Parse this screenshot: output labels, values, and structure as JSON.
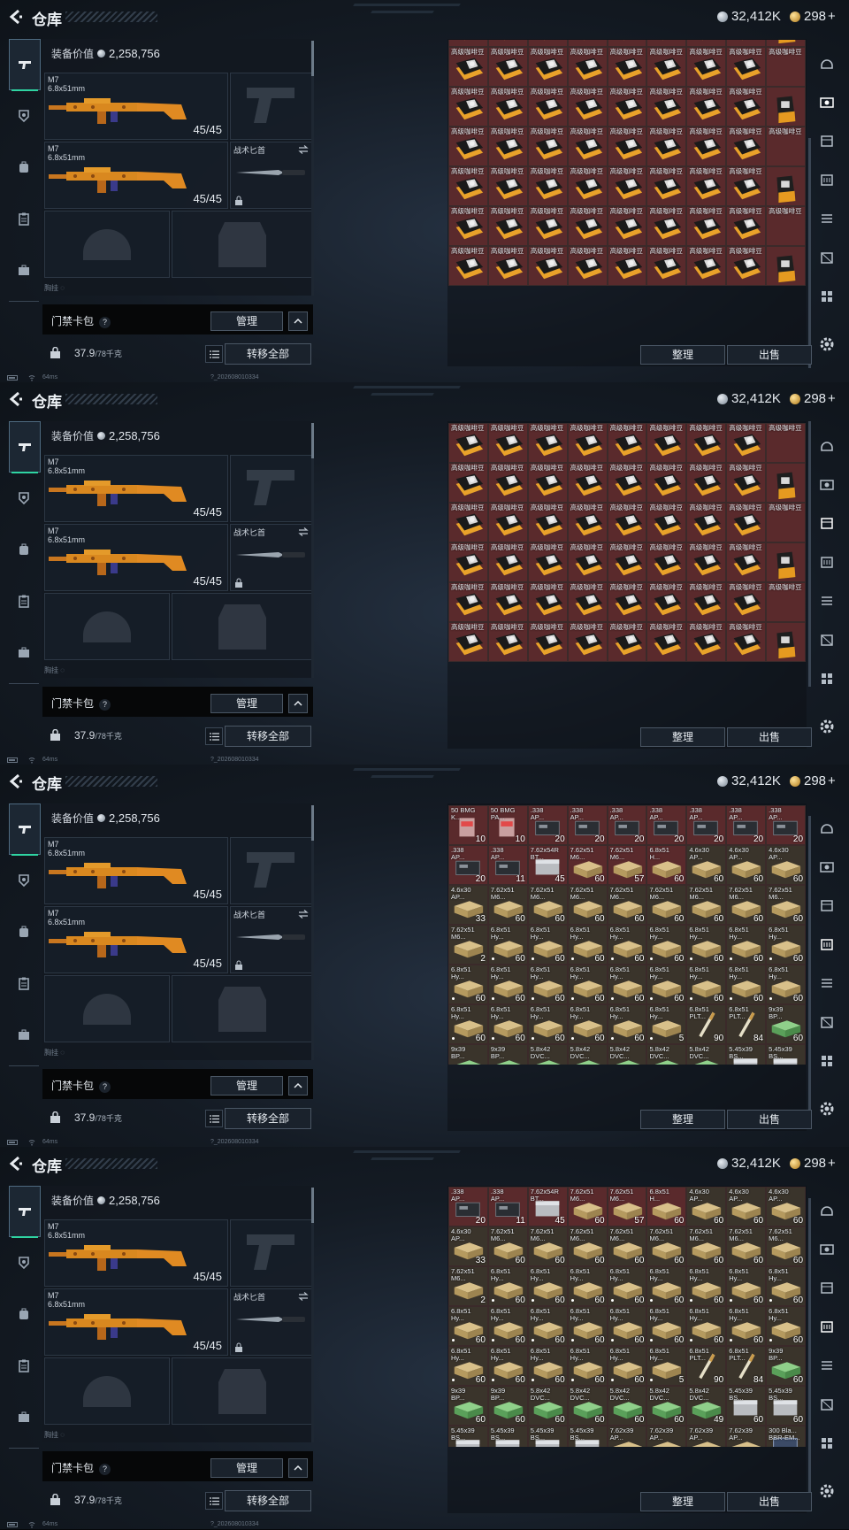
{
  "screens": [
    {
      "title": "仓库",
      "currency_silver": "32,412K",
      "currency_gold": "298",
      "currency_gold_plus": "+",
      "equip_value_label": "装备价值",
      "equip_value": "2,258,756",
      "gun1": {
        "name": "M7",
        "caliber": "6.8x51mm",
        "ammo": "45/45"
      },
      "gun2": {
        "name": "M7",
        "caliber": "6.8x51mm",
        "ammo": "45/45"
      },
      "knife_label": "战术匕首",
      "slot_partial": "胸挂 ◌",
      "keycard_label": "门禁卡包",
      "help": "?",
      "manage": "管理",
      "collapse": "^",
      "weight": "37.9",
      "weight_max": "/78千克",
      "transfer_all": "转移全部",
      "sort": "整理",
      "sell": "出售",
      "ping": "64ms",
      "build": "?_202608010334",
      "active_right": 1
    },
    {
      "title": "仓库",
      "currency_silver": "32,412K",
      "currency_gold": "298",
      "currency_gold_plus": "+",
      "equip_value_label": "装备价值",
      "equip_value": "2,258,756",
      "gun1": {
        "name": "M7",
        "caliber": "6.8x51mm",
        "ammo": "45/45"
      },
      "gun2": {
        "name": "M7",
        "caliber": "6.8x51mm",
        "ammo": "45/45"
      },
      "knife_label": "战术匕首",
      "slot_partial": "胸挂 ◌",
      "keycard_label": "门禁卡包",
      "help": "?",
      "manage": "管理",
      "collapse": "^",
      "weight": "37.9",
      "weight_max": "/78千克",
      "transfer_all": "转移全部",
      "sort": "整理",
      "sell": "出售",
      "ping": "64ms",
      "build": "?_202608010334",
      "active_right": 2
    },
    {
      "title": "仓库",
      "currency_silver": "32,412K",
      "currency_gold": "298",
      "currency_gold_plus": "+",
      "equip_value_label": "装备价值",
      "equip_value": "2,258,756",
      "gun1": {
        "name": "M7",
        "caliber": "6.8x51mm",
        "ammo": "45/45"
      },
      "gun2": {
        "name": "M7",
        "caliber": "6.8x51mm",
        "ammo": "45/45"
      },
      "knife_label": "战术匕首",
      "slot_partial": "胸挂 ◌",
      "keycard_label": "门禁卡包",
      "help": "?",
      "manage": "管理",
      "collapse": "^",
      "weight": "37.9",
      "weight_max": "/78千克",
      "transfer_all": "转移全部",
      "sort": "整理",
      "sell": "出售",
      "ping": "64ms",
      "build": "?_202608010334",
      "active_right": 3
    },
    {
      "title": "仓库",
      "currency_silver": "32,412K",
      "currency_gold": "298",
      "currency_gold_plus": "+",
      "equip_value_label": "装备价值",
      "equip_value": "2,258,756",
      "gun1": {
        "name": "M7",
        "caliber": "6.8x51mm",
        "ammo": "45/45"
      },
      "gun2": {
        "name": "M7",
        "caliber": "6.8x51mm",
        "ammo": "45/45"
      },
      "knife_label": "战术匕首",
      "slot_partial": "胸挂 ◌",
      "keycard_label": "门禁卡包",
      "help": "?",
      "manage": "管理",
      "collapse": "^",
      "weight": "37.9",
      "weight_max": "/78千克",
      "transfer_all": "转移全部",
      "sort": "整理",
      "sell": "出售",
      "ping": "64ms",
      "build": "?_202608010334",
      "active_right": 3
    }
  ],
  "coffee_grid": {
    "label": "高级咖啡豆",
    "rows_screen1": [
      [
        "",
        "",
        "",
        "",
        "",
        "",
        "",
        "",
        ""
      ],
      [
        "高级咖啡豆",
        "高级咖啡豆",
        "高级咖啡豆",
        "高级咖啡豆",
        "高级咖啡豆",
        "高级咖啡豆",
        "高级咖啡豆",
        "高级咖啡豆",
        "高级咖啡豆"
      ],
      [
        "高级咖啡豆",
        "高级咖啡豆",
        "高级咖啡豆",
        "高级咖啡豆",
        "高级咖啡豆",
        "高级咖啡豆",
        "高级咖啡豆",
        "高级咖啡豆",
        ""
      ],
      [
        "高级咖啡豆",
        "高级咖啡豆",
        "高级咖啡豆",
        "高级咖啡豆",
        "高级咖啡豆",
        "高级咖啡豆",
        "高级咖啡豆",
        "高级咖啡豆",
        "高级咖啡豆"
      ],
      [
        "高级咖啡豆",
        "高级咖啡豆",
        "高级咖啡豆",
        "高级咖啡豆",
        "高级咖啡豆",
        "高级咖啡豆",
        "高级咖啡豆",
        "高级咖啡豆",
        ""
      ],
      [
        "高级咖啡豆",
        "高级咖啡豆",
        "高级咖啡豆",
        "高级咖啡豆",
        "高级咖啡豆",
        "高级咖啡豆",
        "高级咖啡豆",
        "高级咖啡豆",
        "高级咖啡豆"
      ],
      [
        "高级咖啡豆",
        "高级咖啡豆",
        "高级咖啡豆",
        "高级咖啡豆",
        "高级咖啡豆",
        "高级咖啡豆",
        "高级咖啡豆",
        "高级咖啡豆",
        ""
      ]
    ],
    "rows_screen2": [
      [
        "高级咖啡豆",
        "高级咖啡豆",
        "高级咖啡豆",
        "高级咖啡豆",
        "高级咖啡豆",
        "高级咖啡豆",
        "高级咖啡豆",
        "高级咖啡豆",
        "高级咖啡豆"
      ],
      [
        "高级咖啡豆",
        "高级咖啡豆",
        "高级咖啡豆",
        "高级咖啡豆",
        "高级咖啡豆",
        "高级咖啡豆",
        "高级咖啡豆",
        "高级咖啡豆",
        ""
      ],
      [
        "高级咖啡豆",
        "高级咖啡豆",
        "高级咖啡豆",
        "高级咖啡豆",
        "高级咖啡豆",
        "高级咖啡豆",
        "高级咖啡豆",
        "高级咖啡豆",
        "高级咖啡豆"
      ],
      [
        "高级咖啡豆",
        "高级咖啡豆",
        "高级咖啡豆",
        "高级咖啡豆",
        "高级咖啡豆",
        "高级咖啡豆",
        "高级咖啡豆",
        "高级咖啡豆",
        ""
      ],
      [
        "高级咖啡豆",
        "高级咖啡豆",
        "高级咖啡豆",
        "高级咖啡豆",
        "高级咖啡豆",
        "高级咖啡豆",
        "高级咖啡豆",
        "高级咖啡豆",
        "高级咖啡豆"
      ],
      [
        "高级咖啡豆",
        "高级咖啡豆",
        "高级咖啡豆",
        "高级咖啡豆",
        "高级咖啡豆",
        "高级咖啡豆",
        "高级咖啡豆",
        "高级咖啡豆",
        ""
      ]
    ]
  },
  "ammo_grid": {
    "rows": [
      [
        [
          "50 BMG\nK...",
          "10",
          "red",
          "box"
        ],
        [
          "50 BMG\nPA...",
          "10",
          "red",
          "box"
        ],
        [
          ".338\nAP...",
          "20",
          "red",
          "mag"
        ],
        [
          ".338\nAP...",
          "20",
          "red",
          "mag"
        ],
        [
          ".338\nAP...",
          "20",
          "red",
          "mag"
        ],
        [
          ".338\nAP...",
          "20",
          "red",
          "mag"
        ],
        [
          ".338\nAP...",
          "20",
          "red",
          "mag"
        ],
        [
          ".338\nAP...",
          "20",
          "red",
          "mag"
        ],
        [
          ".338\nAP...",
          "20",
          "red",
          "mag"
        ]
      ],
      [
        [
          ".338\nAP...",
          "20",
          "red",
          "mag"
        ],
        [
          ".338\nAP...",
          "11",
          "red",
          "mag"
        ],
        [
          "7.62x54R\nBT...",
          "45",
          "red",
          "silver"
        ],
        [
          "7.62x51\nM6...",
          "60",
          "red",
          "tan"
        ],
        [
          "7.62x51\nM6...",
          "57",
          "red",
          "tan"
        ],
        [
          "6.8x51\nH...",
          "60",
          "red",
          "tan"
        ],
        [
          "4.6x30\nAP...",
          "60",
          "dark",
          "tan"
        ],
        [
          "4.6x30\nAP...",
          "60",
          "dark",
          "tan"
        ],
        [
          "4.6x30\nAP...",
          "60",
          "dark",
          "tan"
        ]
      ],
      [
        [
          "4.6x30\nAP...",
          "33",
          "dark",
          "tan"
        ],
        [
          "7.62x51\nM6...",
          "60",
          "dark",
          "tan"
        ],
        [
          "7.62x51\nM6...",
          "60",
          "dark",
          "tan"
        ],
        [
          "7.62x51\nM6...",
          "60",
          "dark",
          "tan"
        ],
        [
          "7.62x51\nM6...",
          "60",
          "dark",
          "tan"
        ],
        [
          "7.62x51\nM6...",
          "60",
          "dark",
          "tan"
        ],
        [
          "7.62x51\nM6...",
          "60",
          "dark",
          "tan"
        ],
        [
          "7.62x51\nM6...",
          "60",
          "dark",
          "tan"
        ],
        [
          "7.62x51\nM6...",
          "60",
          "dark",
          "tan"
        ]
      ],
      [
        [
          "7.62x51\nM6...",
          "2",
          "dark",
          "tan"
        ],
        [
          "6.8x51\nHy...",
          "60",
          "dark",
          "tan",
          "dot"
        ],
        [
          "6.8x51\nHy...",
          "60",
          "dark",
          "tan",
          "dot"
        ],
        [
          "6.8x51\nHy...",
          "60",
          "dark",
          "tan",
          "dot"
        ],
        [
          "6.8x51\nHy...",
          "60",
          "dark",
          "tan",
          "dot"
        ],
        [
          "6.8x51\nHy...",
          "60",
          "dark",
          "tan",
          "dot"
        ],
        [
          "6.8x51\nHy...",
          "60",
          "dark",
          "tan",
          "dot"
        ],
        [
          "6.8x51\nHy...",
          "60",
          "dark",
          "tan",
          "dot"
        ],
        [
          "6.8x51\nHy...",
          "60",
          "dark",
          "tan",
          "dot"
        ]
      ],
      [
        [
          "6.8x51\nHy...",
          "60",
          "dark",
          "tan",
          "dot"
        ],
        [
          "6.8x51\nHy...",
          "60",
          "dark",
          "tan",
          "dot"
        ],
        [
          "6.8x51\nHy...",
          "60",
          "dark",
          "tan",
          "dot"
        ],
        [
          "6.8x51\nHy...",
          "60",
          "dark",
          "tan",
          "dot"
        ],
        [
          "6.8x51\nHy...",
          "60",
          "dark",
          "tan",
          "dot"
        ],
        [
          "6.8x51\nHy...",
          "60",
          "dark",
          "tan",
          "dot"
        ],
        [
          "6.8x51\nHy...",
          "60",
          "dark",
          "tan",
          "dot"
        ],
        [
          "6.8x51\nHy...",
          "60",
          "dark",
          "tan",
          "dot"
        ],
        [
          "6.8x51\nHy...",
          "60",
          "dark",
          "tan",
          "dot"
        ]
      ],
      [
        [
          "6.8x51\nHy...",
          "60",
          "dark",
          "tan",
          "dot"
        ],
        [
          "6.8x51\nHy...",
          "60",
          "dark",
          "tan",
          "dot"
        ],
        [
          "6.8x51\nHy...",
          "60",
          "dark",
          "tan",
          "dot"
        ],
        [
          "6.8x51\nHy...",
          "60",
          "dark",
          "tan",
          "dot"
        ],
        [
          "6.8x51\nHy...",
          "60",
          "dark",
          "tan",
          "dot"
        ],
        [
          "6.8x51\nHy...",
          "5",
          "dark",
          "tan",
          "dot"
        ],
        [
          "6.8x51\nPLT...",
          "90",
          "dark",
          "round"
        ],
        [
          "6.8x51\nPLT...",
          "84",
          "dark",
          "round"
        ],
        [
          "9x39\nBP...",
          "60",
          "dark",
          "green"
        ]
      ],
      [
        [
          "9x39\nBP...",
          "60",
          "dark",
          "green"
        ],
        [
          "9x39\nBP...",
          "60",
          "dark",
          "green"
        ],
        [
          "5.8x42\nDVC...",
          "60",
          "dark",
          "green"
        ],
        [
          "5.8x42\nDVC...",
          "60",
          "dark",
          "green"
        ],
        [
          "5.8x42\nDVC...",
          "60",
          "dark",
          "green"
        ],
        [
          "5.8x42\nDVC...",
          "60",
          "dark",
          "green"
        ],
        [
          "5.8x42\nDVC...",
          "49",
          "dark",
          "green"
        ],
        [
          "5.45x39\nBS...",
          "60",
          "dark",
          "silver"
        ],
        [
          "5.45x39\nBS...",
          "60",
          "dark",
          "silver"
        ]
      ],
      [
        [
          "5.45x39\nBS...",
          "60",
          "dark",
          "silver"
        ],
        [
          "5.45x39\nBS...",
          "60",
          "dark",
          "silver"
        ],
        [
          "5.45x39\nBS...",
          "60",
          "dark",
          "silver"
        ],
        [
          "5.45x39\nBS...",
          "60",
          "dark",
          "silver"
        ],
        [
          "7.62x39\nAP...",
          "60",
          "dark",
          "tan"
        ],
        [
          "7.62x39\nAP...",
          "60",
          "dark",
          "tan"
        ],
        [
          "7.62x39\nAP...",
          "60",
          "dark",
          "tan"
        ],
        [
          "7.62x39\nAP...",
          "60",
          "dark",
          "tan"
        ],
        [
          "300 Bla...\nBBR-EM...",
          "60",
          "dark",
          "blue"
        ]
      ]
    ]
  },
  "colors": {
    "accent": "#2fd4a2",
    "coffee_bg": "#5a2a2c",
    "ammo_bg": "#3a342b"
  }
}
